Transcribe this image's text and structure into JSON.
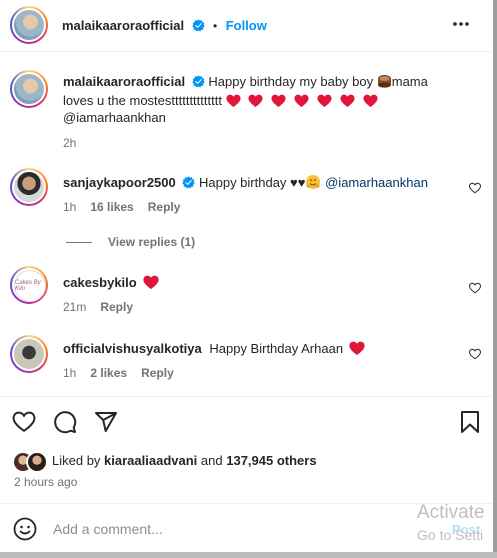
{
  "header": {
    "username": "malaikaaroraofficial",
    "dot": "•",
    "follow_label": "Follow",
    "more_icon": "more-horizontal-icon"
  },
  "caption": {
    "username": "malaikaaroraofficial",
    "text_part1": "Happy birthday my baby boy ",
    "text_part2": "mama",
    "text_line2": "loves u the mostestttttttttttttt",
    "mention": "@iamarhaankhan",
    "time": "2h"
  },
  "comments": [
    {
      "username": "sanjaykapoor2500",
      "text": "Happy birthday ♥♥",
      "mention": "@iamarhaankhan",
      "time": "1h",
      "likes": "16 likes",
      "reply": "Reply",
      "view_replies": "View replies (1)"
    },
    {
      "username": "cakesbykilo",
      "avatar_text": "Cakes By Kilo",
      "text": "",
      "time": "21m",
      "reply": "Reply"
    },
    {
      "username": "officialvishusyalkotiya",
      "text": "Happy Birthday Arhaan",
      "time": "1h",
      "likes": "2 likes",
      "reply": "Reply"
    }
  ],
  "liked_by": {
    "prefix": "Liked by",
    "user": "kiaraaliaadvani",
    "middle": "and",
    "others": "137,945 others"
  },
  "post_time": "2 hours ago",
  "add_comment": {
    "placeholder": "Add a comment...",
    "post_label": "Post"
  },
  "watermark": {
    "line1": "Activate",
    "line2": "Go to Setti"
  },
  "colors": {
    "link": "#0095f6",
    "heart": "#ed4956",
    "mention": "#00376b",
    "muted": "#737373"
  }
}
